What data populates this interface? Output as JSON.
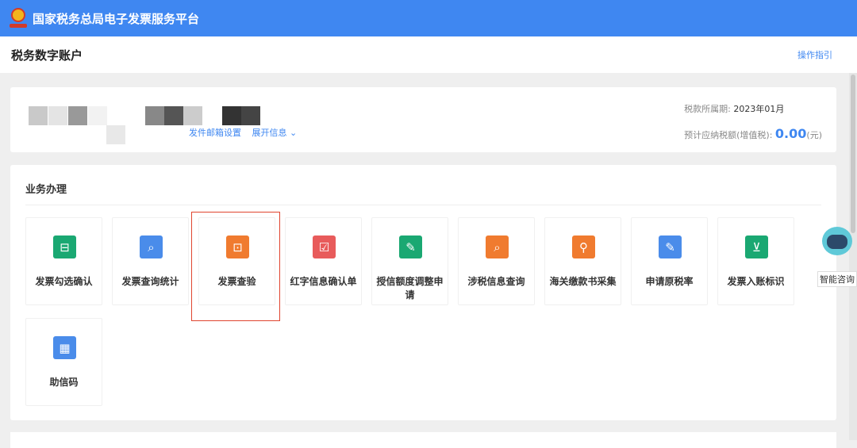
{
  "header": {
    "title": "国家税务总局电子发票服务平台"
  },
  "subheader": {
    "title": "税务数字账户",
    "guide": "操作指引"
  },
  "account": {
    "mailbox_setting": "发件邮箱设置",
    "expand_info": "展开信息 ⌄",
    "period_label": "税款所属期:",
    "period_value": "2023年01月",
    "tax_label": "预计应纳税额(增值税):",
    "tax_value": "0.00",
    "tax_unit": "(元)"
  },
  "business": {
    "title": "业务办理",
    "tiles": [
      {
        "label": "发票勾选确认",
        "icon": "ticket-icon",
        "color": "#1aa872",
        "glyph": "⊟"
      },
      {
        "label": "发票查询统计",
        "icon": "search-doc-icon",
        "color": "#4a8cea",
        "glyph": "⌕"
      },
      {
        "label": "发票查验",
        "icon": "ticket-verify-icon",
        "color": "#f07b2f",
        "glyph": "⊡"
      },
      {
        "label": "红字信息确认单",
        "icon": "doc-check-icon",
        "color": "#e85b5b",
        "glyph": "☑"
      },
      {
        "label": "授信额度调整申请",
        "icon": "edit-doc-icon",
        "color": "#1aa872",
        "glyph": "✎"
      },
      {
        "label": "涉税信息查询",
        "icon": "folder-search-icon",
        "color": "#f07b2f",
        "glyph": "⌕"
      },
      {
        "label": "海关缴款书采集",
        "icon": "doc-location-icon",
        "color": "#f07b2f",
        "glyph": "⚲"
      },
      {
        "label": "申请原税率",
        "icon": "pen-doc-icon",
        "color": "#4a8cea",
        "glyph": "✎"
      },
      {
        "label": "发票入账标识",
        "icon": "inbox-icon",
        "color": "#1aa872",
        "glyph": "⊻"
      },
      {
        "label": "助信码",
        "icon": "qr-code-icon",
        "color": "#4a8cea",
        "glyph": "▦"
      }
    ]
  },
  "assistant": {
    "label": "智能咨询"
  }
}
